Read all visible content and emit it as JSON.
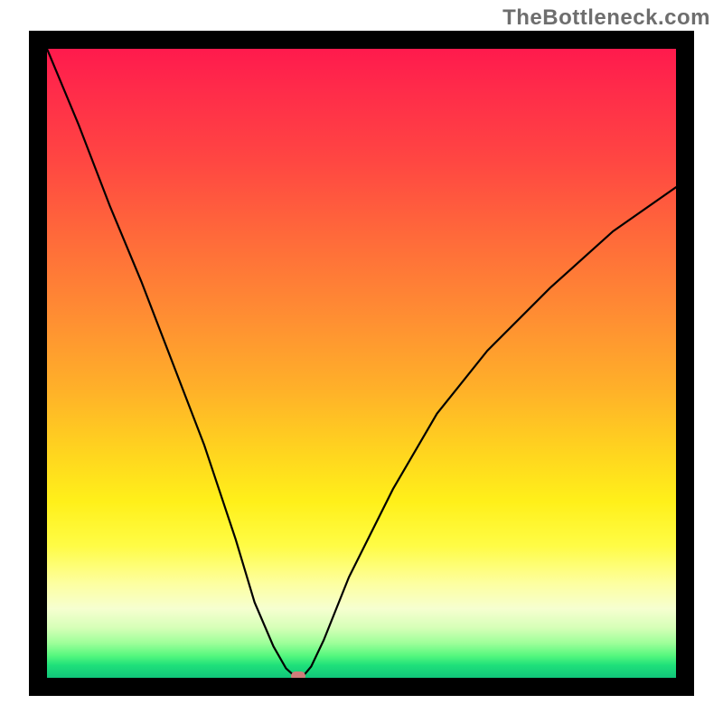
{
  "watermark": "TheBottleneck.com",
  "chart_data": {
    "type": "line",
    "title": "",
    "xlabel": "",
    "ylabel": "",
    "xlim": [
      0,
      100
    ],
    "ylim": [
      0,
      100
    ],
    "grid": false,
    "legend": false,
    "series": [
      {
        "name": "bottleneck-curve",
        "x": [
          0,
          5,
          10,
          15,
          20,
          25,
          30,
          33,
          36,
          38,
          39,
          40,
          41,
          42,
          44,
          48,
          55,
          62,
          70,
          80,
          90,
          100
        ],
        "values": [
          100,
          88,
          75,
          63,
          50,
          37,
          22,
          12,
          5,
          1.5,
          0.6,
          0.3,
          0.6,
          1.8,
          6,
          16,
          30,
          42,
          52,
          62,
          71,
          78
        ]
      }
    ],
    "annotations": [
      {
        "name": "optimal-marker",
        "x": 40,
        "y": 0.3
      }
    ],
    "background": {
      "type": "vertical-gradient",
      "stops": [
        {
          "pos": 0,
          "color": "#ff1a4d"
        },
        {
          "pos": 0.3,
          "color": "#ff6a3a"
        },
        {
          "pos": 0.64,
          "color": "#ffd41f"
        },
        {
          "pos": 0.85,
          "color": "#fdffa0"
        },
        {
          "pos": 1.0,
          "color": "#11c57a"
        }
      ]
    }
  },
  "colors": {
    "curve": "#000000",
    "frame": "#000000",
    "marker": "#d07d7a"
  }
}
